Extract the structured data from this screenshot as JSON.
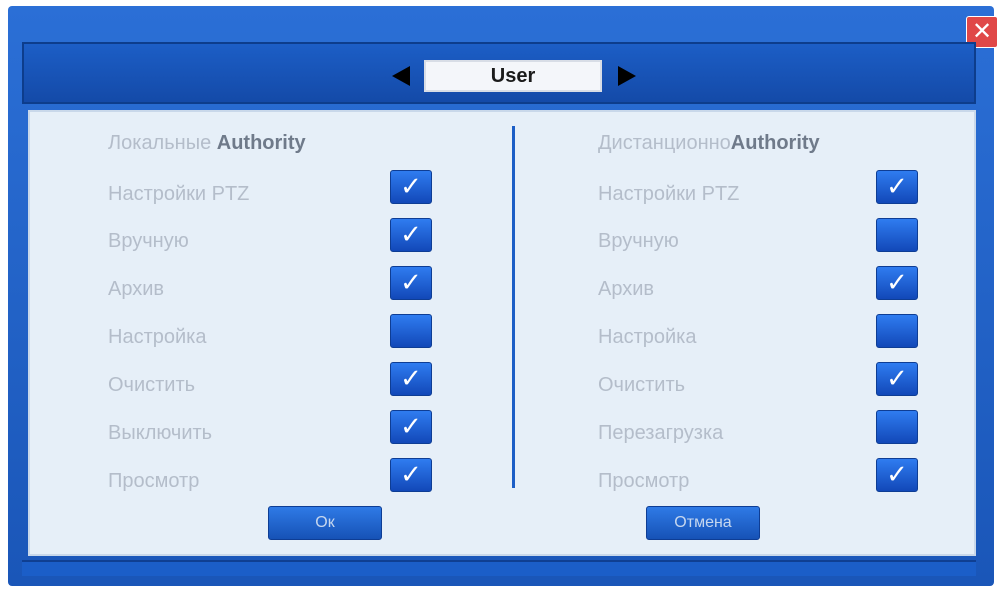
{
  "dialog": {
    "user_label": "User",
    "close_glyph": "✕"
  },
  "left": {
    "heading_prefix": "Локальные ",
    "heading_bold": "Authority",
    "items": [
      {
        "label": "Настройки PTZ",
        "checked": true
      },
      {
        "label": "Вручную",
        "checked": true
      },
      {
        "label": "Архив",
        "checked": true
      },
      {
        "label": "Настройка",
        "checked": false
      },
      {
        "label": "Очистить",
        "checked": true
      },
      {
        "label": "Выключить",
        "checked": true
      },
      {
        "label": "Просмотр",
        "checked": true
      }
    ],
    "button_label": "Ок"
  },
  "right": {
    "heading_prefix": "Дистанционно",
    "heading_bold": "Authority",
    "items": [
      {
        "label": "Настройки PTZ",
        "checked": true
      },
      {
        "label": "Вручную",
        "checked": false
      },
      {
        "label": "Архив",
        "checked": true
      },
      {
        "label": "Настройка",
        "checked": false
      },
      {
        "label": "Очистить",
        "checked": true
      },
      {
        "label": "Перезагрузка",
        "checked": false
      },
      {
        "label": "Просмотр",
        "checked": true
      }
    ],
    "button_label": "Отмена"
  },
  "icons": {
    "check": "✓",
    "prev": "arrow-left-icon",
    "next": "arrow-right-icon",
    "close": "close-icon"
  },
  "colors": {
    "frame": "#1a56b8",
    "panel": "#e6eff8",
    "checkbox": "#1f63d8"
  }
}
